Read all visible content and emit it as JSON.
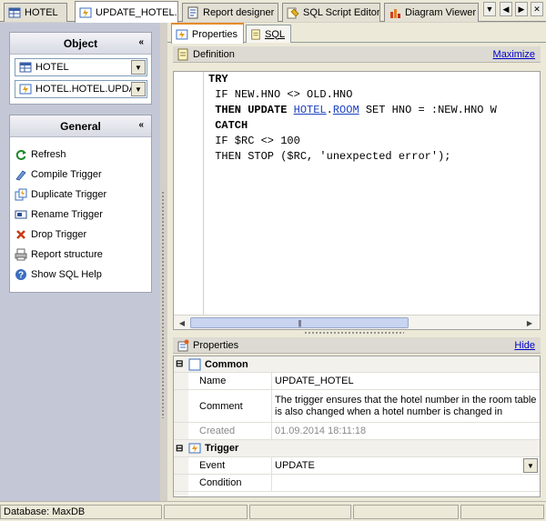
{
  "tabs": [
    {
      "label": "HOTEL",
      "icon": "table-icon",
      "active": false
    },
    {
      "label": "UPDATE_HOTEL...",
      "icon": "trigger-icon",
      "active": true
    },
    {
      "label": "Report designer",
      "icon": "report-icon",
      "active": false
    },
    {
      "label": "SQL Script Editor",
      "icon": "script-icon",
      "active": false
    },
    {
      "label": "Diagram Viewer",
      "icon": "diagram-icon",
      "active": false
    }
  ],
  "tab_nav": {
    "dropdown": "▼",
    "prev": "◀",
    "next": "▶",
    "close": "✕"
  },
  "object_panel": {
    "title": "Object",
    "collapse": "«",
    "table_combo": "HOTEL",
    "trigger_combo": "HOTEL.HOTEL.UPDAT"
  },
  "general_panel": {
    "title": "General",
    "collapse": "«",
    "items": [
      {
        "label": "Refresh",
        "icon": "refresh-icon"
      },
      {
        "label": "Compile Trigger",
        "icon": "compile-icon"
      },
      {
        "label": "Duplicate Trigger",
        "icon": "duplicate-icon"
      },
      {
        "label": "Rename Trigger",
        "icon": "rename-icon"
      },
      {
        "label": "Drop Trigger",
        "icon": "drop-icon"
      },
      {
        "label": "Report structure",
        "icon": "report-structure-icon"
      },
      {
        "label": "Show SQL Help",
        "icon": "help-icon"
      }
    ]
  },
  "subtabs": [
    {
      "label": "Properties",
      "active": true
    },
    {
      "label": "SQL",
      "active": false
    }
  ],
  "definition": {
    "title": "Definition",
    "action": "Maximize",
    "code": {
      "l1": "TRY",
      "l2a": " IF NEW.HNO <> OLD.HNO",
      "l3a": " THEN UPDATE ",
      "l3b": "HOTEL",
      "l3c": ".",
      "l3d": "ROOM",
      "l3e": " SET HNO = :NEW.HNO W",
      "l4": " CATCH",
      "l5": " IF $RC <> 100",
      "l6": " THEN STOP ($RC, 'unexpected error');"
    }
  },
  "properties": {
    "title": "Properties",
    "action": "Hide",
    "common": {
      "title": "Common",
      "toggle": "⊟",
      "rows": [
        {
          "name": "Name",
          "value": "UPDATE_HOTEL"
        },
        {
          "name": "Comment",
          "value": "The trigger ensures that the hotel number in the room table is also changed when a hotel number is changed in"
        },
        {
          "name": "Created",
          "value": "01.09.2014 18:11:18"
        }
      ]
    },
    "trigger": {
      "title": "Trigger",
      "toggle": "⊟",
      "rows": [
        {
          "name": "Event",
          "value": "UPDATE"
        },
        {
          "name": "Condition",
          "value": ""
        }
      ]
    }
  },
  "status": {
    "database": "Database: MaxDB"
  }
}
